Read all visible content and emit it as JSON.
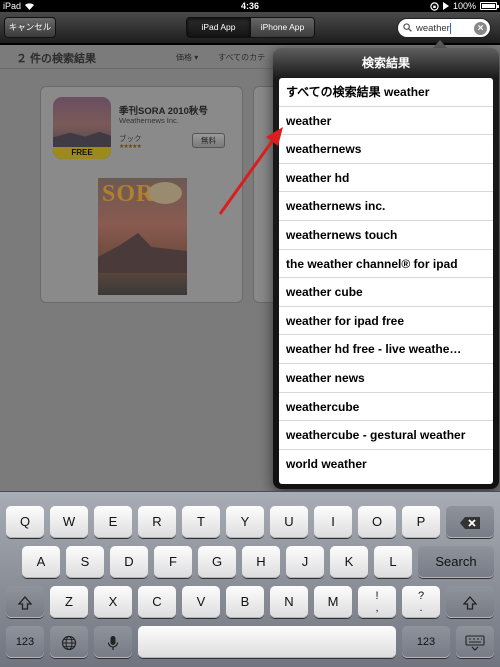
{
  "status": {
    "device": "iPad",
    "time": "4:36",
    "battery": "100%"
  },
  "toolbar": {
    "cancel": "キャンセル",
    "segments": [
      "iPad App",
      "iPhone App"
    ],
    "search_value": "weather"
  },
  "content": {
    "result_count": "２ 件の検索結果",
    "filters": [
      "価格 ▾",
      "すべてのカテ"
    ],
    "app": {
      "title": "季刊SORA 2010秋号",
      "developer": "Weathernews Inc.",
      "category": "ブック",
      "stars": "★★★★★",
      "price": "無料",
      "free_badge": "FREE",
      "cover_logo": "SORA"
    }
  },
  "popover": {
    "title": "検索結果",
    "items": [
      "すべての検索結果 weather",
      "weather",
      "weathernews",
      "weather hd",
      "weathernews inc.",
      "weathernews touch",
      "the weather channel® for ipad",
      "weather cube",
      "weather for ipad free",
      "weather hd free - live weathe…",
      "weather news",
      "weathercube",
      "weathercube - gestural weather",
      "world weather"
    ]
  },
  "keyboard": {
    "row1": [
      "Q",
      "W",
      "E",
      "R",
      "T",
      "Y",
      "U",
      "I",
      "O",
      "P"
    ],
    "row2": [
      "A",
      "S",
      "D",
      "F",
      "G",
      "H",
      "J",
      "K",
      "L"
    ],
    "row3": [
      "Z",
      "X",
      "C",
      "V",
      "B",
      "N",
      "M",
      "!\n,",
      "?\n."
    ],
    "search": "Search",
    "numbers": "123"
  },
  "colors": {
    "annotation_arrow": "#d81e1e",
    "caret": "#2b6bd6"
  }
}
